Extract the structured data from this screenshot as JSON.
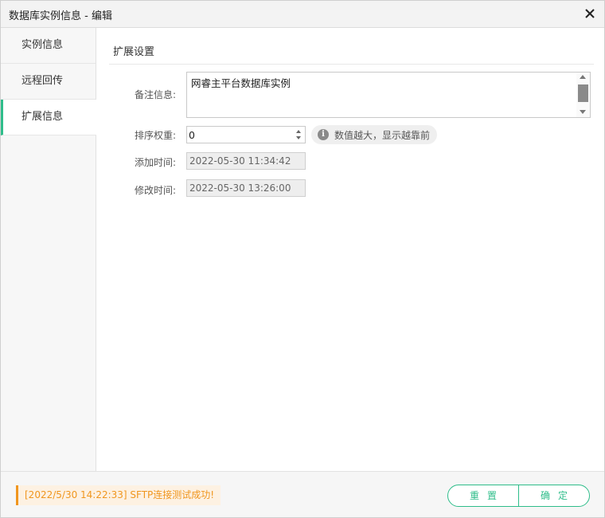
{
  "window": {
    "title": "数据库实例信息 - 编辑"
  },
  "icons": {
    "close": "close-icon",
    "info": "info-icon"
  },
  "colors": {
    "accent": "#2ebd8a",
    "status": "#f0961e"
  },
  "sidebar": {
    "items": [
      {
        "label": "实例信息",
        "active": false
      },
      {
        "label": "远程回传",
        "active": false
      },
      {
        "label": "扩展信息",
        "active": true
      }
    ]
  },
  "main": {
    "section_title": "扩展设置",
    "remark": {
      "label": "备注信息:",
      "value": "网睿主平台数据库实例"
    },
    "sort": {
      "label": "排序权重:",
      "value": "0",
      "hint": "数值越大，显示越靠前"
    },
    "created": {
      "label": "添加时间:",
      "value": "2022-05-30 11:34:42"
    },
    "modified": {
      "label": "修改时间:",
      "value": "2022-05-30 13:26:00"
    }
  },
  "footer": {
    "status": "[2022/5/30  14:22:33]  SFTP连接测试成功!",
    "reset_label": "重置",
    "confirm_label": "确定"
  }
}
